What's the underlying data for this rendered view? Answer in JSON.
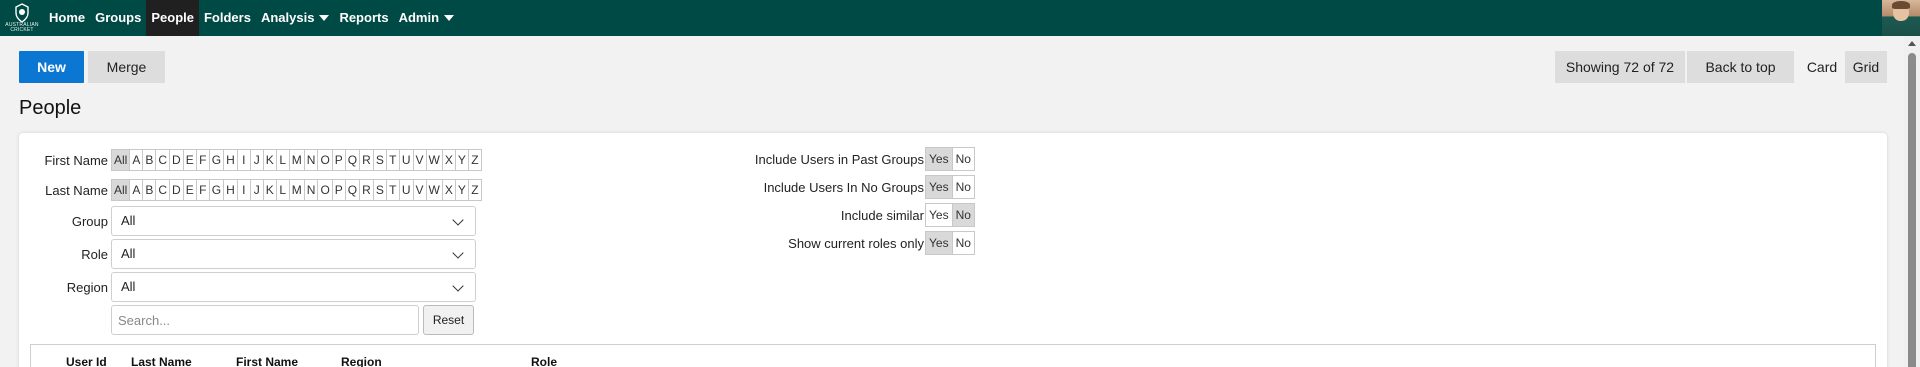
{
  "nav": {
    "logo_text": [
      "AUSTRALIAN",
      "CRICKET"
    ],
    "items": [
      {
        "label": "Home"
      },
      {
        "label": "Groups"
      },
      {
        "label": "People"
      },
      {
        "label": "Folders"
      },
      {
        "label": "Analysis"
      },
      {
        "label": "Reports"
      },
      {
        "label": "Admin"
      }
    ],
    "active": "People",
    "header_color": "#004a45"
  },
  "toolbar": {
    "new_label": "New",
    "merge_label": "Merge",
    "showing_label": "Showing 72 of 72",
    "back_to_top_label": "Back to top",
    "card_label": "Card",
    "grid_label": "Grid",
    "accent_color": "#0c77d2"
  },
  "page": {
    "title": "People"
  },
  "filters": {
    "first_name_label": "First Name",
    "last_name_label": "Last Name",
    "letters": [
      "All",
      "A",
      "B",
      "C",
      "D",
      "E",
      "F",
      "G",
      "H",
      "I",
      "J",
      "K",
      "L",
      "M",
      "N",
      "O",
      "P",
      "Q",
      "R",
      "S",
      "T",
      "U",
      "V",
      "W",
      "X",
      "Y",
      "Z"
    ],
    "first_name_selected": "All",
    "last_name_selected": "All",
    "group_label": "Group",
    "group_value": "All",
    "role_label": "Role",
    "role_value": "All",
    "region_label": "Region",
    "region_value": "All",
    "search_placeholder": "Search...",
    "reset_label": "Reset",
    "toggles": [
      {
        "label": "Include Users in Past Groups",
        "yes": "Yes",
        "no": "No",
        "selected": "Yes"
      },
      {
        "label": "Include Users In No Groups",
        "yes": "Yes",
        "no": "No",
        "selected": "Yes"
      },
      {
        "label": "Include similar",
        "yes": "Yes",
        "no": "No",
        "selected": "No"
      },
      {
        "label": "Show current roles only",
        "yes": "Yes",
        "no": "No",
        "selected": "Yes"
      }
    ]
  },
  "table": {
    "columns": [
      "User Id",
      "Last Name",
      "First Name",
      "Region",
      "Role"
    ]
  }
}
